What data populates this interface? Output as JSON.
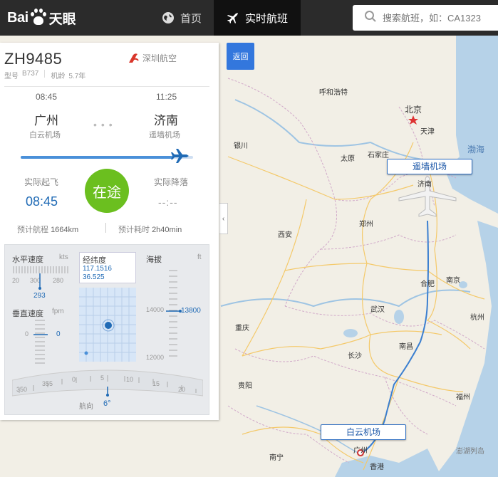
{
  "app": {
    "logo_text": "Bai",
    "logo_text_cn": "天眼"
  },
  "nav": {
    "home_label": "首页",
    "realtime_label": "实时航班",
    "search_placeholder": "搜索航班，如：CA1323"
  },
  "colors": {
    "topbar": "#2b2b2b",
    "accent_blue": "#1f6ab5",
    "status_green": "#6bbf1f",
    "route_line": "#4a90d9"
  },
  "flight": {
    "number": "ZH9485",
    "airline": "深圳航空",
    "model_label": "型号",
    "model": "B737",
    "age_label": "机龄",
    "age": "5.7年",
    "dep_time": "08:45",
    "arr_time": "11:25",
    "dep_city": "广州",
    "arr_city": "济南",
    "dep_airport": "白云机场",
    "arr_airport": "遥墙机场",
    "progress": 0.88,
    "actual_dep_label": "实际起飞",
    "actual_dep": "08:45",
    "actual_arr_label": "实际降落",
    "actual_arr": "--:--",
    "status": "在途",
    "distance_label": "预计航程",
    "distance": "1664km",
    "duration_label": "预计耗时",
    "duration": "2h40min"
  },
  "instruments": {
    "hspeed_label": "水平速度",
    "hspeed_unit": "kts",
    "hspeed_ticks": [
      "20",
      "300",
      "280"
    ],
    "hspeed_value": "293",
    "vspeed_label": "垂直速度",
    "vspeed_unit": "fpm",
    "vspeed_tick": "0",
    "vspeed_value": "0",
    "coord_label": "经纬度",
    "longitude": "117.1516",
    "latitude": "36.525",
    "alt_label": "海拔",
    "alt_unit": "ft",
    "alt_ticks": [
      "14000",
      "12000"
    ],
    "alt_value": "13800",
    "heading_ticks": [
      "350",
      "355",
      "0",
      "5",
      "10",
      "15",
      "20"
    ],
    "heading_label": "航向",
    "heading_value": "6°"
  },
  "map": {
    "back_label": "返回",
    "collapse_icon": "‹",
    "dep_tag": "白云机场",
    "arr_tag": "遥墙机场",
    "cities": [
      {
        "name": "呼和浩特",
        "cls": "city"
      },
      {
        "name": "北京",
        "cls": "city big"
      },
      {
        "name": "天津",
        "cls": "city"
      },
      {
        "name": "渤海",
        "cls": "city sea"
      },
      {
        "name": "银川",
        "cls": "city"
      },
      {
        "name": "太原",
        "cls": "city"
      },
      {
        "name": "石家庄",
        "cls": "city"
      },
      {
        "name": "济南",
        "cls": "city"
      },
      {
        "name": "郑州",
        "cls": "city"
      },
      {
        "name": "西安",
        "cls": "city"
      },
      {
        "name": "合肥",
        "cls": "city"
      },
      {
        "name": "南京",
        "cls": "city"
      },
      {
        "name": "武汉",
        "cls": "city"
      },
      {
        "name": "杭州",
        "cls": "city"
      },
      {
        "name": "重庆",
        "cls": "city"
      },
      {
        "name": "长沙",
        "cls": "city"
      },
      {
        "name": "南昌",
        "cls": "city"
      },
      {
        "name": "贵阳",
        "cls": "city"
      },
      {
        "name": "福州",
        "cls": "city"
      },
      {
        "name": "南宁",
        "cls": "city"
      },
      {
        "name": "广州",
        "cls": "city"
      },
      {
        "name": "香港",
        "cls": "city"
      },
      {
        "name": "澎湖列岛",
        "cls": "city"
      }
    ]
  }
}
